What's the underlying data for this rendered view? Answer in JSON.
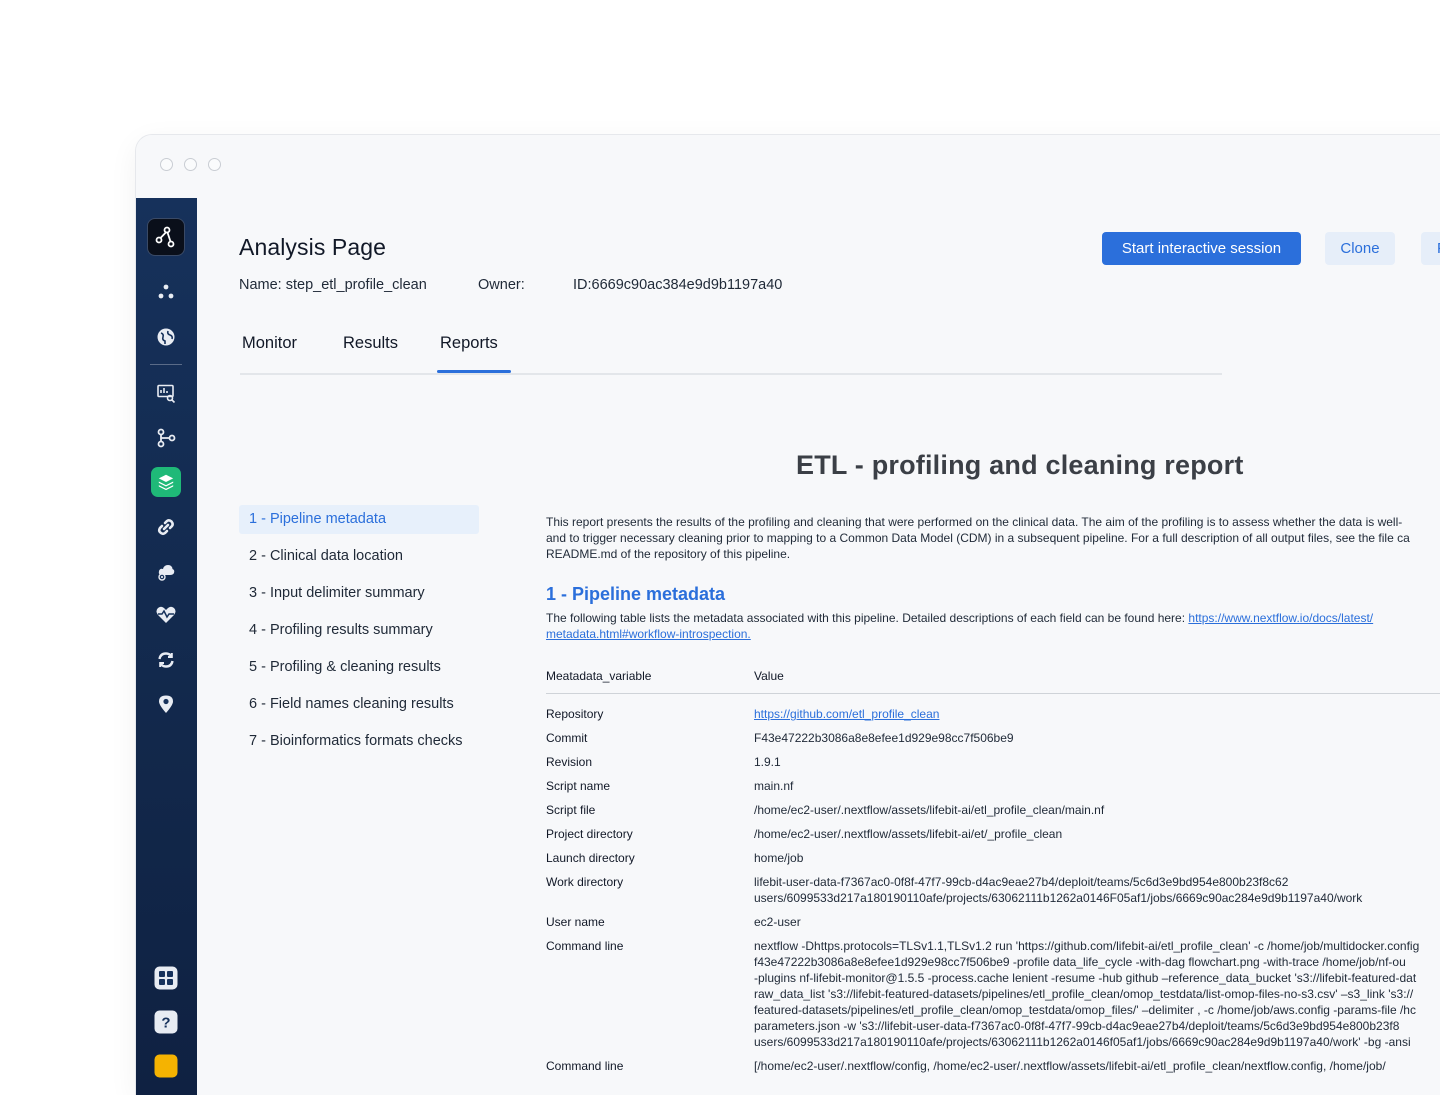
{
  "page": {
    "title": "Analysis Page",
    "name": "Name: step_etl_profile_clean",
    "owner": "Owner:",
    "id": "ID:6669c90ac384e9d9b1197a40"
  },
  "actions": {
    "start_session": "Start interactive session",
    "clone": "Clone",
    "third": "F"
  },
  "tabs": [
    {
      "label": "Monitor"
    },
    {
      "label": "Results"
    },
    {
      "label": "Reports"
    }
  ],
  "sidebar": {
    "icons": [
      "logo-icon",
      "projects-icon",
      "globe-icon",
      "data-analysis-icon",
      "workflow-icon",
      "analyses-icon",
      "link-icon",
      "cloud-os-icon",
      "health-icon",
      "sync-icon",
      "location-icon",
      "apps-grid-icon",
      "help-icon",
      "user-avatar"
    ]
  },
  "report": {
    "title": "ETL - profiling and cleaning report",
    "toc": [
      {
        "label": "1 - Pipeline metadata"
      },
      {
        "label": "2 - Clinical data location"
      },
      {
        "label": "3 - Input delimiter summary"
      },
      {
        "label": "4 - Profiling results summary"
      },
      {
        "label": "5 - Profiling & cleaning results"
      },
      {
        "label": "6 - Field names cleaning results"
      },
      {
        "label": "7 - Bioinformatics formats checks"
      }
    ],
    "intro": [
      "This report presents the results of the profiling and cleaning that were performed on the clinical data. The aim of the profiling is to assess whether the data is well-",
      "and to trigger necessary cleaning prior to mapping to a Common Data Model (CDM) in a subsequent pipeline. For a full description of all output files, see the file ca",
      "README.md of the repository of this pipeline."
    ],
    "section1": {
      "title": "1 - Pipeline metadata",
      "desc_prefix": "The following table lists the metadata associated with this pipeline. Detailed descriptions of each field can be found here: ",
      "link_line1": "https://www.nextflow.io/docs/latest/",
      "link_line2": "metadata.html#workflow-introspection."
    },
    "table": {
      "col_key": "Meatadata_variable",
      "col_value": "Value",
      "rows": [
        {
          "key": "Repository",
          "lines": [
            "https://github.com/etl_profile_clean"
          ],
          "link": true
        },
        {
          "key": "Commit",
          "lines": [
            "F43e47222b3086a8e8efee1d929e98cc7f506be9"
          ]
        },
        {
          "key": "Revision",
          "lines": [
            "1.9.1"
          ]
        },
        {
          "key": "Script name",
          "lines": [
            "main.nf"
          ]
        },
        {
          "key": "Script file",
          "lines": [
            "/home/ec2-user/.nextflow/assets/lifebit-ai/etl_profile_clean/main.nf"
          ]
        },
        {
          "key": "Project directory",
          "lines": [
            "/home/ec2-user/.nextflow/assets/lifebit-ai/et/_profile_clean"
          ]
        },
        {
          "key": "Launch directory",
          "lines": [
            "home/job"
          ]
        },
        {
          "key": "Work directory",
          "lines": [
            "lifebit-user-data-f7367ac0-0f8f-47f7-99cb-d4ac9eae27b4/deploit/teams/5c6d3e9bd954e800b23f8c62",
            "users/6099533d217a180190110afe/projects/63062111b1262a0146F05af1/jobs/6669c90ac284e9d9b1197a40/work"
          ]
        },
        {
          "key": "User name",
          "lines": [
            "ec2-user"
          ]
        },
        {
          "key": "Command line",
          "lines": [
            "nextflow -Dhttps.protocols=TLSv1.1,TLSv1.2 run 'https://github.com/lifebit-ai/etl_profile_clean' -c /home/job/multidocker.config",
            "f43e47222b3086a8e8efee1d929e98cc7f506be9 -profile data_life_cycle -with-dag flowchart.png -with-trace /home/job/nf-ou",
            "-plugins nf-lifebit-monitor@1.5.5 -process.cache lenient -resume -hub github –reference_data_bucket 's3://lifebit-featured-dat",
            "raw_data_list 's3://lifebit-featured-datasets/pipelines/etl_profile_clean/omop_testdata/list-omop-files-no-s3.csv' –s3_link 's3://",
            "featured-datasets/pipelines/etl_profile_clean/omop_testdata/omop_files/' –delimiter , -c /home/job/aws.config -params-file /hc",
            "parameters.json -w 's3://lifebit-user-data-f7367ac0-0f8f-47f7-99cb-d4ac9eae27b4/deploit/teams/5c6d3e9bd954e800b23f8",
            "users/6099533d217a180190110afe/projects/63062111b1262a0146f05af1/jobs/6669c90ac284e9d9b1197a40/work' -bg -ansi"
          ]
        },
        {
          "key": "Command line",
          "lines": [
            "[/home/ec2-user/.nextflow/config, /home/ec2-user/.nextflow/assets/lifebit-ai/etl_profile_clean/nextflow.config, /home/job/"
          ]
        }
      ]
    }
  },
  "colors": {
    "sidebar": "#16315b",
    "accent": "#2b6fdb",
    "active_icon": "#1fb978",
    "toc_active_bg": "#e7f0fb"
  }
}
